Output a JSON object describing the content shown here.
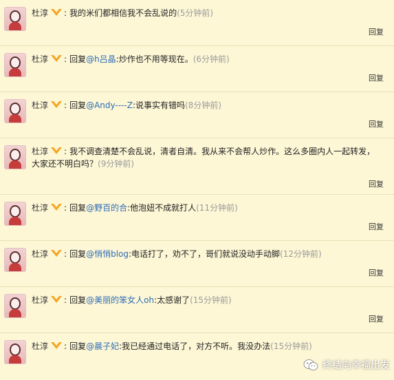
{
  "comments": [
    {
      "user": "杜淳",
      "prefix": "",
      "mention": "",
      "text": "我的米们都相信我不会乱说的",
      "time": "(5分钟前)",
      "reply_label": "回复"
    },
    {
      "user": "杜淳",
      "prefix": "回复",
      "mention": "@h吕晶",
      "text": ":炒作也不用等现在。",
      "time": "(6分钟前)",
      "reply_label": "回复"
    },
    {
      "user": "杜淳",
      "prefix": "回复",
      "mention": "@Andy----Z",
      "text": ":说事实有错吗",
      "time": "(8分钟前)",
      "reply_label": "回复"
    },
    {
      "user": "杜淳",
      "prefix": "",
      "mention": "",
      "text": "我不调查清楚不会乱说，清者自清。我从来不会帮人炒作。这么多圈内人一起转发，大家还不明白吗？",
      "time": "(9分钟前)",
      "reply_label": "回复"
    },
    {
      "user": "杜淳",
      "prefix": "回复",
      "mention": "@野百的合",
      "text": ":他泡妞不成就打人",
      "time": "(11分钟前)",
      "reply_label": "回复"
    },
    {
      "user": "杜淳",
      "prefix": "回复",
      "mention": "@悄悄blog",
      "text": ":电话打了，劝不了，哥们就说没动手动脚",
      "time": "(12分钟前)",
      "reply_label": "回复"
    },
    {
      "user": "杜淳",
      "prefix": "回复",
      "mention": "@美丽的笨女人oh",
      "text": ":太感谢了",
      "time": "(15分钟前)",
      "reply_label": "回复"
    },
    {
      "user": "杜淳",
      "prefix": "回复",
      "mention": "@晨子妃",
      "text": ":我已经通过电话了，对方不听。我没办法",
      "time": "(15分钟前)",
      "reply_label": ""
    }
  ],
  "watermark": {
    "text": "终结向幸福出发",
    "icon": "wechat-icon"
  },
  "colors": {
    "background": "#fdf7d6",
    "mention": "#2d6bb5",
    "time": "#9a9a9a",
    "verified_badge": "#f5a623"
  }
}
